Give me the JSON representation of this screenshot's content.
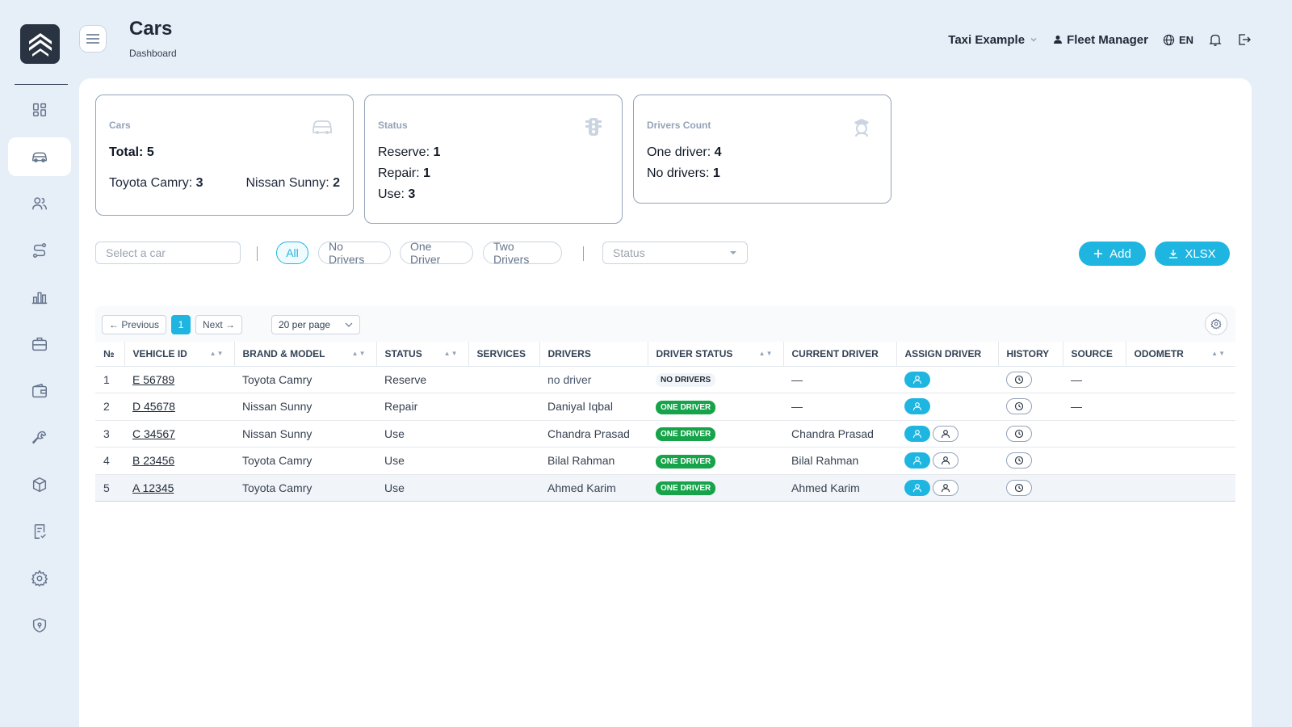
{
  "header": {
    "title": "Cars",
    "subtitle": "Dashboard",
    "company": "Taxi Example",
    "user": "Fleet Manager",
    "language": "EN"
  },
  "sidebar": {
    "items": [
      {
        "name": "dashboard"
      },
      {
        "name": "cars",
        "active": true
      },
      {
        "name": "drivers"
      },
      {
        "name": "routes"
      },
      {
        "name": "reports"
      },
      {
        "name": "business"
      },
      {
        "name": "wallet"
      },
      {
        "name": "services"
      },
      {
        "name": "products"
      },
      {
        "name": "tasks"
      },
      {
        "name": "settings"
      },
      {
        "name": "security"
      }
    ]
  },
  "cards": {
    "cars": {
      "title": "Cars",
      "total_label": "Total:",
      "total_value": "5",
      "model1_label": "Toyota Camry:",
      "model1_value": "3",
      "model2_label": "Nissan Sunny:",
      "model2_value": "2"
    },
    "status": {
      "title": "Status",
      "reserve_label": "Reserve:",
      "reserve_value": "1",
      "repair_label": "Repair:",
      "repair_value": "1",
      "use_label": "Use:",
      "use_value": "3"
    },
    "drivers": {
      "title": "Drivers Count",
      "one_label": "One driver:",
      "one_value": "4",
      "none_label": "No drivers:",
      "none_value": "1"
    }
  },
  "filters": {
    "select_car_placeholder": "Select a car",
    "chips": [
      "All",
      "No Drivers",
      "One Driver",
      "Two Drivers"
    ],
    "active_chip": "All",
    "status_placeholder": "Status",
    "add_label": "Add",
    "xlsx_label": "XLSX"
  },
  "pagination": {
    "previous": "← Previous",
    "current_page": "1",
    "next": "Next →",
    "per_page": "20 per page"
  },
  "table": {
    "columns": [
      "№",
      "VEHICLE ID",
      "BRAND & MODEL",
      "STATUS",
      "SERVICES",
      "DRIVERS",
      "DRIVER STATUS",
      "CURRENT DRIVER",
      "ASSIGN DRIVER",
      "HISTORY",
      "SOURCE",
      "ODOMETR"
    ],
    "rows": [
      {
        "n": "1",
        "vehicle_id": "E 56789",
        "model": "Toyota Camry",
        "status": "Reserve",
        "services": "",
        "drivers": "no driver",
        "driver_status": "NO DRIVERS",
        "current_driver": "—",
        "source": "—",
        "odometer": ""
      },
      {
        "n": "2",
        "vehicle_id": "D 45678",
        "model": "Nissan Sunny",
        "status": "Repair",
        "services": "",
        "drivers": "Daniyal Iqbal",
        "driver_status": "ONE DRIVER",
        "current_driver": "—",
        "source": "—",
        "odometer": ""
      },
      {
        "n": "3",
        "vehicle_id": "C 34567",
        "model": "Nissan Sunny",
        "status": "Use",
        "services": "",
        "drivers": "Chandra Prasad",
        "driver_status": "ONE DRIVER",
        "current_driver": "Chandra Prasad",
        "source": "",
        "odometer": ""
      },
      {
        "n": "4",
        "vehicle_id": "B 23456",
        "model": "Toyota Camry",
        "status": "Use",
        "services": "",
        "drivers": "Bilal Rahman",
        "driver_status": "ONE DRIVER",
        "current_driver": "Bilal Rahman",
        "source": "",
        "odometer": ""
      },
      {
        "n": "5",
        "vehicle_id": "A 12345",
        "model": "Toyota Camry",
        "status": "Use",
        "services": "",
        "drivers": "Ahmed Karim",
        "driver_status": "ONE DRIVER",
        "current_driver": "Ahmed Karim",
        "source": "",
        "odometer": ""
      }
    ]
  },
  "colors": {
    "accent": "#1fb5e1",
    "success": "#16a34a",
    "sidebar_bg": "#e6eef8",
    "logo_bg": "#2a3342"
  }
}
